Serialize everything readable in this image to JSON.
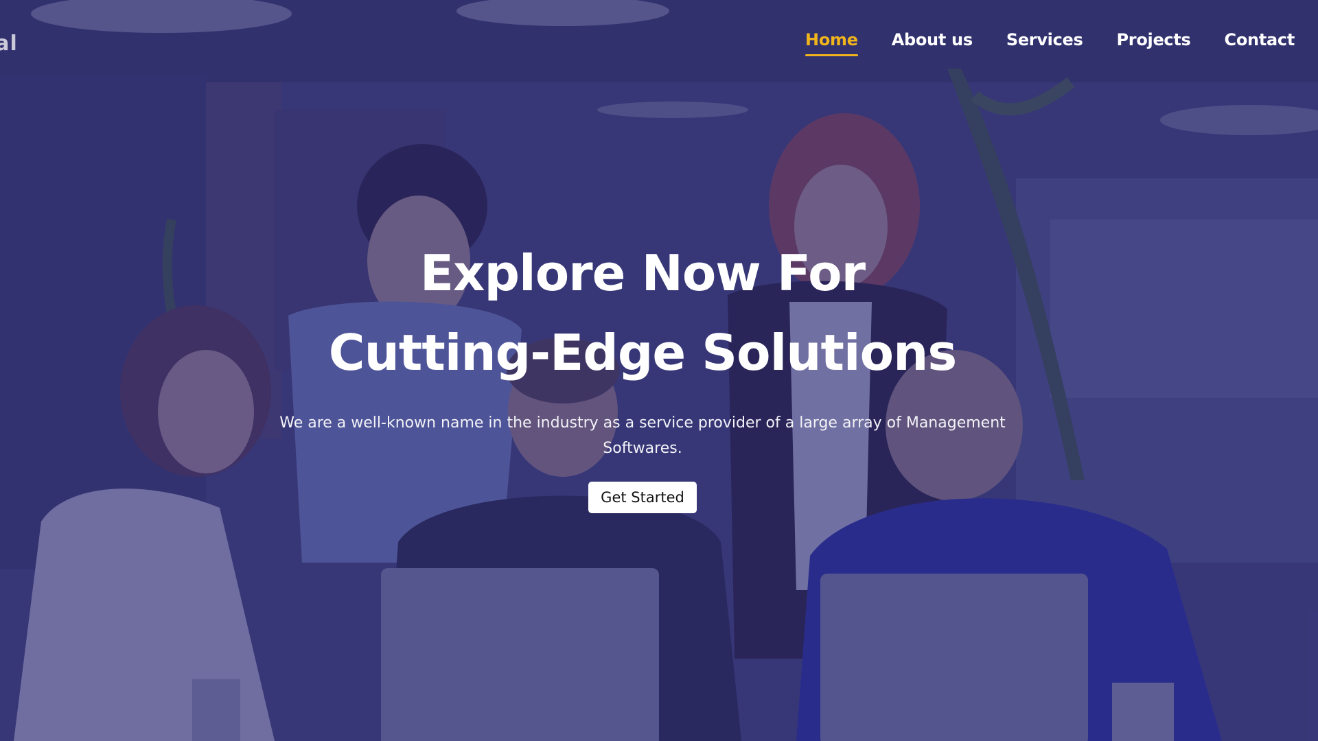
{
  "brand": {
    "logo_text": "ial"
  },
  "nav": {
    "items": [
      {
        "label": "Home",
        "active": true
      },
      {
        "label": "About us",
        "active": false
      },
      {
        "label": "Services",
        "active": false
      },
      {
        "label": "Projects",
        "active": false
      },
      {
        "label": "Contact",
        "active": false
      }
    ]
  },
  "hero": {
    "title_line1": "Explore Now For",
    "title_line2": "Cutting-Edge Solutions",
    "subtitle": "We are a well-known name in the industry as a service provider of a large array of Management Softwares.",
    "cta_label": "Get Started"
  },
  "colors": {
    "accent": "#f1b51c",
    "overlay": "#28246e",
    "text": "#ffffff",
    "button_bg": "#ffffff"
  }
}
